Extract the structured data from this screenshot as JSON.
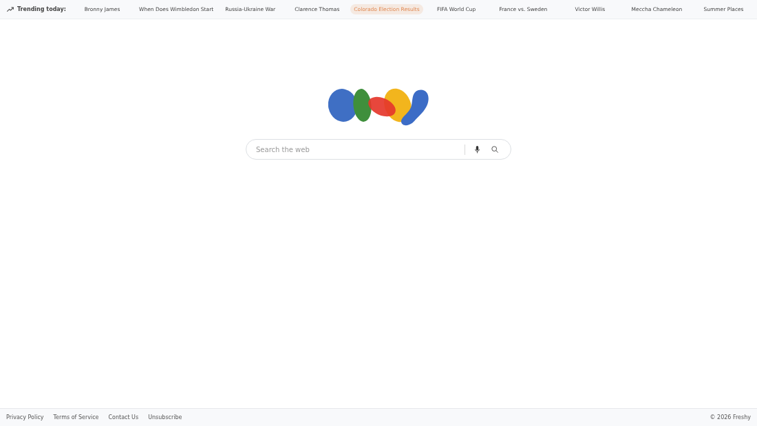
{
  "trending": {
    "label": "Trending today:",
    "items": [
      {
        "label": "Bronny James",
        "selected": false
      },
      {
        "label": "When Does Wimbledon Start",
        "selected": false
      },
      {
        "label": "Russia-Ukraine War",
        "selected": false
      },
      {
        "label": "Clarence Thomas",
        "selected": false
      },
      {
        "label": "Colorado Election Results",
        "selected": true
      },
      {
        "label": "FIFA World Cup",
        "selected": false
      },
      {
        "label": "France vs. Sweden",
        "selected": false
      },
      {
        "label": "Victor Willis",
        "selected": false
      },
      {
        "label": "Meccha Chameleon",
        "selected": false
      },
      {
        "label": "Summer Places",
        "selected": false
      }
    ]
  },
  "search": {
    "placeholder": "Search the web"
  },
  "footer": {
    "links": [
      "Privacy Policy",
      "Terms of Service",
      "Contact Us",
      "Unsubscribe"
    ],
    "copyright": "© 2026 Freshy"
  }
}
